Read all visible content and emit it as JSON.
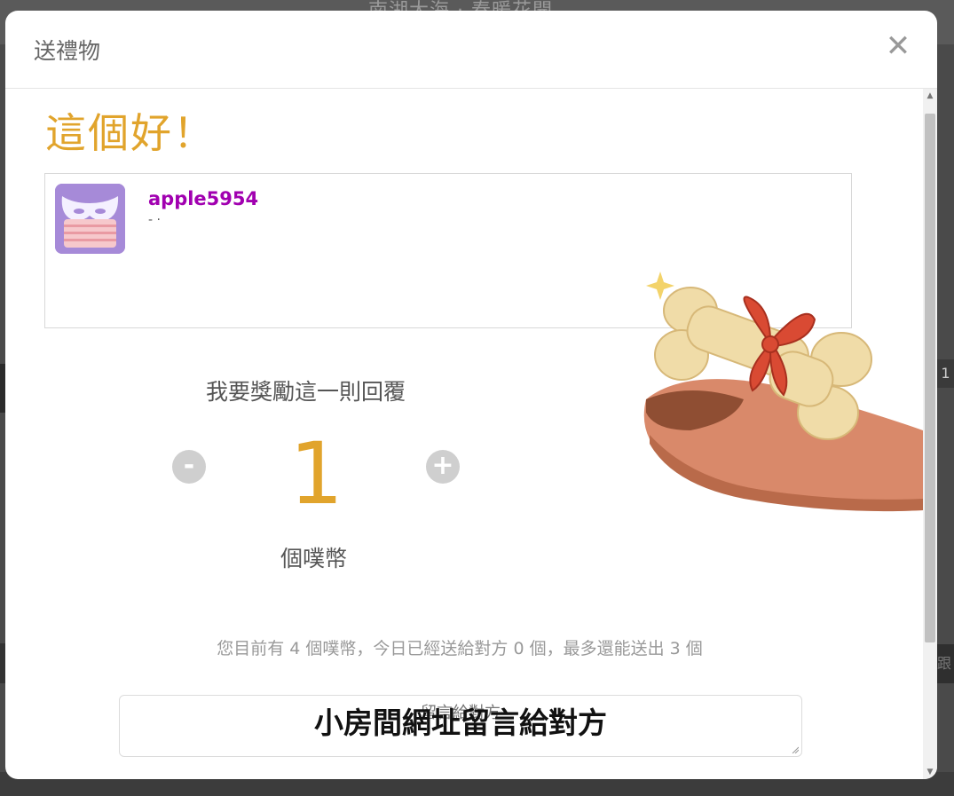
{
  "background": {
    "title": "南湖大海 · 春暖花開",
    "right_badge": "1",
    "right_text": "跟"
  },
  "modal": {
    "title": "送禮物",
    "close_icon": "close-icon",
    "headline": "這個好！",
    "reply": {
      "username": "apple5954",
      "text": "-                                                    ·"
    },
    "reward": {
      "label": "我要獎勵這一則回覆",
      "minus_label": "-",
      "plus_label": "+",
      "amount": "1",
      "unit": "個噗幣"
    },
    "info": "您目前有 4 個噗幣，今日已經送給對方 0 個，最多還能送出 3 個",
    "message": {
      "placeholder": "留言給對方",
      "overlay": "小房間網址留言給對方"
    }
  },
  "colors": {
    "accent": "#e1a42c",
    "username": "#a100b0",
    "button_gray": "#cfcfcf"
  }
}
